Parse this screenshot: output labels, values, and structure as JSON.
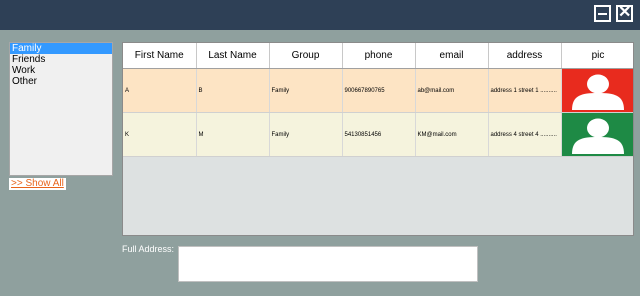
{
  "window": {
    "minimize_label": "",
    "close_glyph": "✕"
  },
  "groups": [
    "Family",
    "Friends",
    "Work",
    "Other"
  ],
  "selected_group": "Family",
  "show_all_label": ">> Show All",
  "table": {
    "columns": [
      "First Name",
      "Last Name",
      "Group",
      "phone",
      "email",
      "address",
      "pic"
    ],
    "rows": [
      {
        "first": "A",
        "last": "B",
        "group": "Family",
        "phone": "900667890765",
        "email": "ab@mail.com",
        "address": "address 1 street 1 ..........",
        "avatar_color": "#e82b1e",
        "row_color": "#fde4c4"
      },
      {
        "first": "K",
        "last": "M",
        "group": "Family",
        "phone": "54130851456",
        "email": "KM@mail.com",
        "address": "address 4 street 4 ..........",
        "avatar_color": "#1e8a45",
        "row_color": "#f5f3dd"
      }
    ]
  },
  "full_address": {
    "label": "Full Address:",
    "value": ""
  }
}
